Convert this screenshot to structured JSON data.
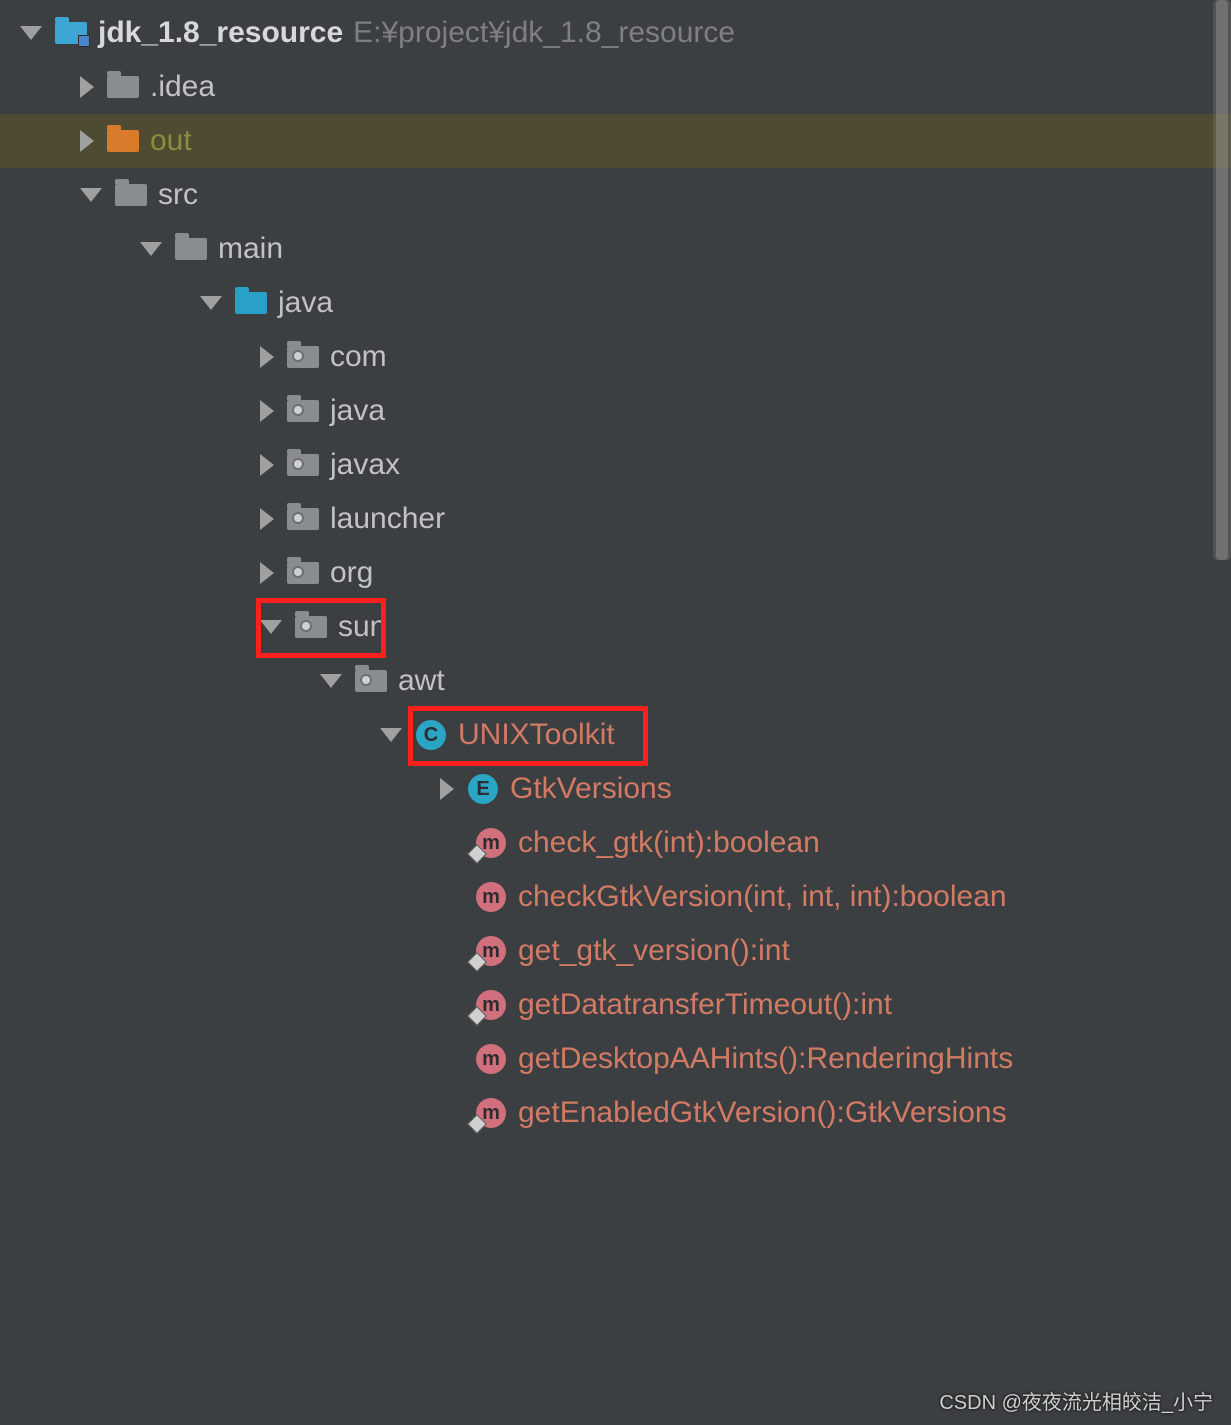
{
  "root": {
    "name": "jdk_1.8_resource",
    "path": "E:¥project¥jdk_1.8_resource"
  },
  "nodes": {
    "idea": ".idea",
    "out": "out",
    "src": "src",
    "main": "main",
    "java": "java",
    "pkg_com": "com",
    "pkg_java": "java",
    "pkg_javax": "javax",
    "pkg_launcher": "launcher",
    "pkg_org": "org",
    "pkg_sun": "sun",
    "pkg_awt": "awt",
    "class_unixtoolkit": "UNIXToolkit",
    "enum_gtkversions": "GtkVersions",
    "m_check_gtk": "check_gtk(int):boolean",
    "m_checkGtkVersion": "checkGtkVersion(int, int, int):boolean",
    "m_get_gtk_version": "get_gtk_version():int",
    "m_getDatatransferTimeout": "getDatatransferTimeout():int",
    "m_getDesktopAAHints": "getDesktopAAHints():RenderingHints",
    "m_getEnabledGtkVersion": "getEnabledGtkVersion():GtkVersions"
  },
  "badges": {
    "C": "C",
    "E": "E",
    "M": "m"
  },
  "watermark": "CSDN @夜夜流光相皎洁_小宁"
}
